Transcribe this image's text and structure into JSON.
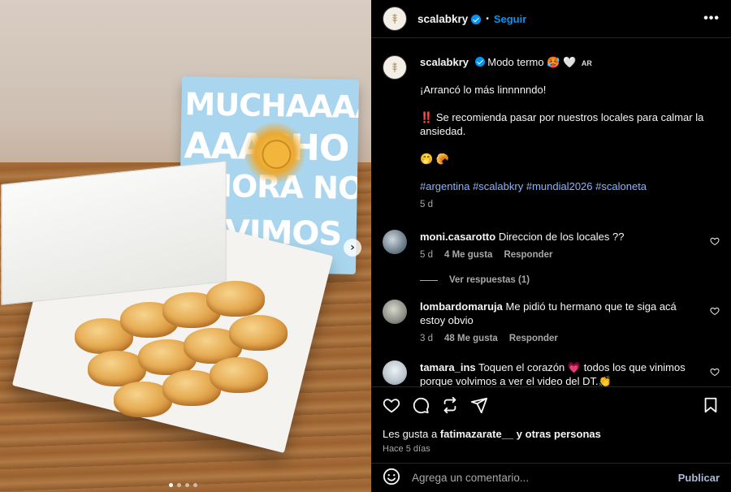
{
  "post": {
    "username": "scalabkry",
    "follow_label": "Seguir",
    "more_label": "•••",
    "separator": "•"
  },
  "photo": {
    "box_text": [
      "MUCHAAAA",
      "AAACHO",
      "AHORA NO",
      "OLVIMOS"
    ],
    "slide_count": 4,
    "current_slide": 1
  },
  "caption": {
    "username": "scalabkry",
    "title": "Modo termo",
    "emojis_title": "🥵 🤍",
    "flag_label": "AR",
    "line1": "¡Arrancó lo más linnnnndo!",
    "line2_prefix": "‼️",
    "line2": "Se recomienda pasar por nuestros locales para calmar la ansiedad.",
    "line3": "🤭 🥐",
    "hashtags": [
      "#argentina",
      "#scalabkry",
      "#mundial2026",
      "#scaloneta"
    ],
    "time": "5 d"
  },
  "comments": [
    {
      "username": "moni.casarotto",
      "text": "Direccion de los locales ??",
      "time": "5 d",
      "likes": "4 Me gusta",
      "reply_label": "Responder",
      "avatar_color": "#6d7f8c",
      "view_replies": "Ver respuestas (1)"
    },
    {
      "username": "lombardomaruja",
      "text": "Me pidió tu hermano que te siga acá estoy obvio",
      "time": "3 d",
      "likes": "48 Me gusta",
      "reply_label": "Responder",
      "avatar_color": "#8a8f86"
    },
    {
      "username": "tamara_ins",
      "text_before": "Toquen el corazón",
      "emoji_heart": "💗",
      "text_after": "todos los que vinimos porque volvimos a ver el video del DT.",
      "emoji_end": "👏",
      "avatar_color": "#b8c4cc"
    }
  ],
  "actions": {
    "likes_prefix": "Les gusta a",
    "likes_user": "fatimazarate__",
    "likes_suffix": "y otras personas",
    "date": "Hace 5 días"
  },
  "composer": {
    "placeholder": "Agrega un comentario...",
    "publish_label": "Publicar"
  },
  "colors": {
    "accent": "#0095f6",
    "hashtag": "#89b4ff",
    "background": "#000000",
    "heart_pink": "#e8508b"
  }
}
